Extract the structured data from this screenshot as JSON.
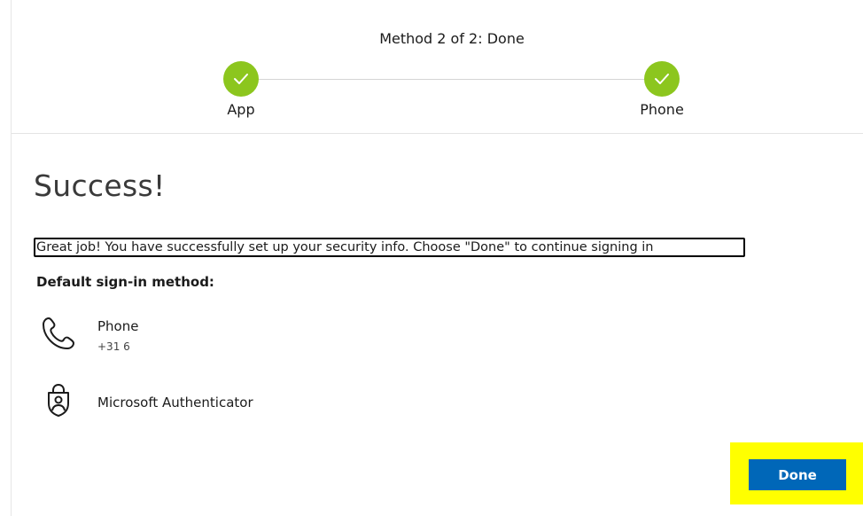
{
  "steps": {
    "title": "Method 2 of 2: Done",
    "items": [
      {
        "label": "App",
        "status": "complete"
      },
      {
        "label": "Phone",
        "status": "complete"
      }
    ],
    "complete_color": "#8cc61e"
  },
  "main": {
    "heading": "Success!",
    "message": "Great job! You have successfully set up your security info. Choose \"Done\" to continue signing in",
    "default_label": "Default sign-in method:",
    "methods": [
      {
        "name": "Phone",
        "detail": "+31 6",
        "icon": "phone-icon"
      },
      {
        "name": "Microsoft Authenticator",
        "icon": "authenticator-icon"
      }
    ]
  },
  "footer": {
    "done_label": "Done",
    "button_color": "#0067b8",
    "highlight_color": "#ffff00"
  }
}
